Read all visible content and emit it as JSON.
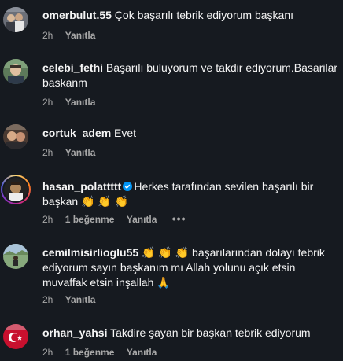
{
  "comments": [
    {
      "username": "omerbulut.55",
      "text": "Çok başarılı tebrik ediyorum başkanı",
      "time": "2h",
      "likes": "",
      "reply": "Yanıtla"
    },
    {
      "username": "celebi_fethi",
      "text": "Başarılı buluyorum ve takdir ediyorum.Basarilar baskanm",
      "time": "2h",
      "likes": "",
      "reply": "Yanıtla"
    },
    {
      "username": "cortuk_adem",
      "text": "Evet",
      "time": "2h",
      "likes": "",
      "reply": "Yanıtla"
    },
    {
      "username": "hasan_polattttt",
      "verified": true,
      "text": "Herkes tarafından sevilen başarılı bir başkan 👏 👏 👏",
      "time": "2h",
      "likes": "1 beğenme",
      "reply": "Yanıtla",
      "more": "•••"
    },
    {
      "username": "cemilmisirlioglu55",
      "text": "👏 👏 👏 başarılarından dolayı tebrik ediyorum sayın başkanım mı Allah yolunu açık etsin muvaffak etsin inşallah 🙏",
      "time": "2h",
      "likes": "",
      "reply": "Yanıtla"
    },
    {
      "username": "orhan_yahsi",
      "text": "Takdire şayan bir başkan tebrik ediyorum",
      "time": "2h",
      "likes": "1 beğenme",
      "reply": "Yanıtla"
    }
  ],
  "colors": {
    "background": "#161a20",
    "text": "#f5f5f5",
    "meta": "#a8a8a8",
    "verified": "#0095f6"
  }
}
